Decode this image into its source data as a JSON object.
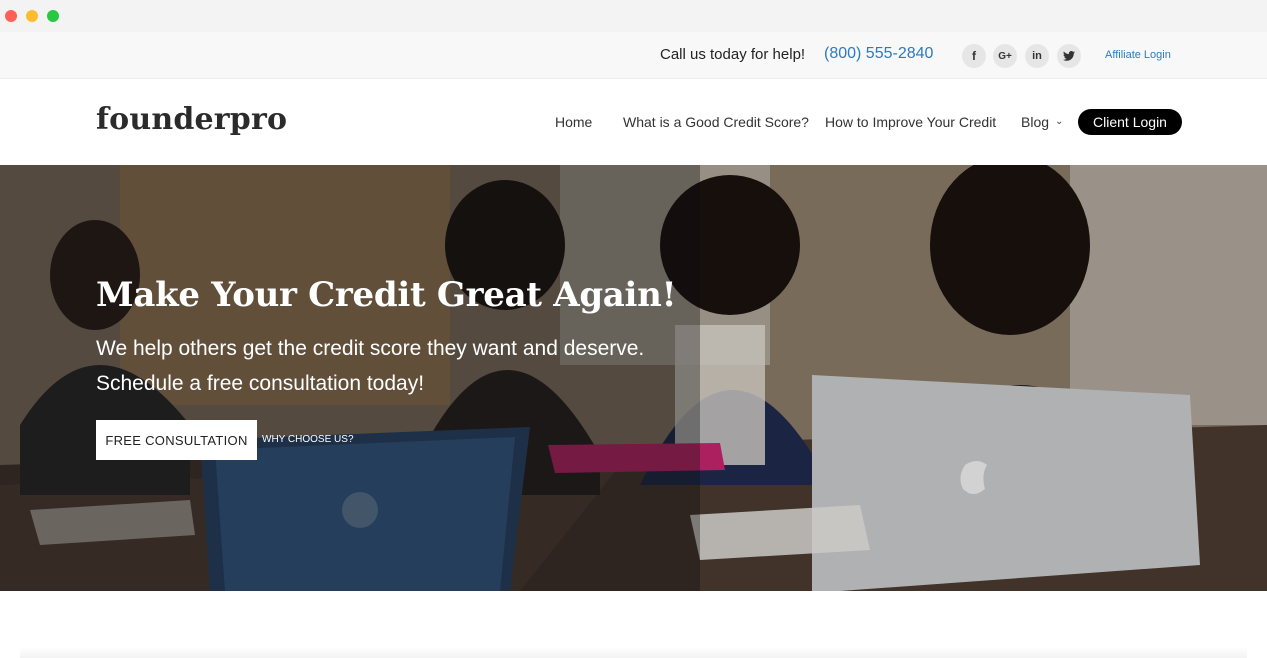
{
  "topbar": {
    "call_text": "Call us today for help!",
    "phone": "(800) 555-2840",
    "social": [
      {
        "icon": "facebook-icon",
        "glyph": "f"
      },
      {
        "icon": "google-plus-icon",
        "glyph": "G+"
      },
      {
        "icon": "linkedin-icon",
        "glyph": "in"
      },
      {
        "icon": "twitter-icon",
        "glyph": "🐦"
      }
    ],
    "affiliate_login": "Affiliate Login"
  },
  "nav": {
    "logo": "founderpro",
    "items": [
      "Home",
      "What is a Good Credit Score?",
      "How to Improve Your Credit",
      "Blog"
    ],
    "blog_chevron": "⌄",
    "client_login": "Client Login"
  },
  "hero": {
    "title": "Make Your Credit Great Again!",
    "subtitle_line1": "We help others get the credit score they want and deserve.",
    "subtitle_line2": "Schedule a free consultation today!",
    "primary_button": "FREE CONSULTATION",
    "secondary_link": "WHY CHOOSE US?"
  },
  "colors": {
    "accent_link": "#2b7bc1",
    "client_login_bg": "#000000"
  }
}
